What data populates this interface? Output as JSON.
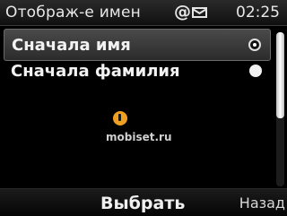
{
  "status": {
    "title": "Отображ-е имен",
    "at_symbol": "@",
    "icons": [
      "at-icon",
      "mail-icon"
    ],
    "time": "02:25"
  },
  "options": [
    {
      "label": "Сначала имя",
      "selected": true
    },
    {
      "label": "Сначала фамилия",
      "selected": false
    }
  ],
  "scrollbar": {
    "position_fraction": 0.0,
    "visible_fraction": 0.56
  },
  "watermark": {
    "text": "mobiset.ru",
    "icon": "music-note-logo-icon"
  },
  "softkeys": {
    "select": "Выбрать",
    "back": "Назад"
  },
  "colors": {
    "background": "#000000",
    "text": "#ffffff",
    "watermark_orange": "#f0a020"
  }
}
